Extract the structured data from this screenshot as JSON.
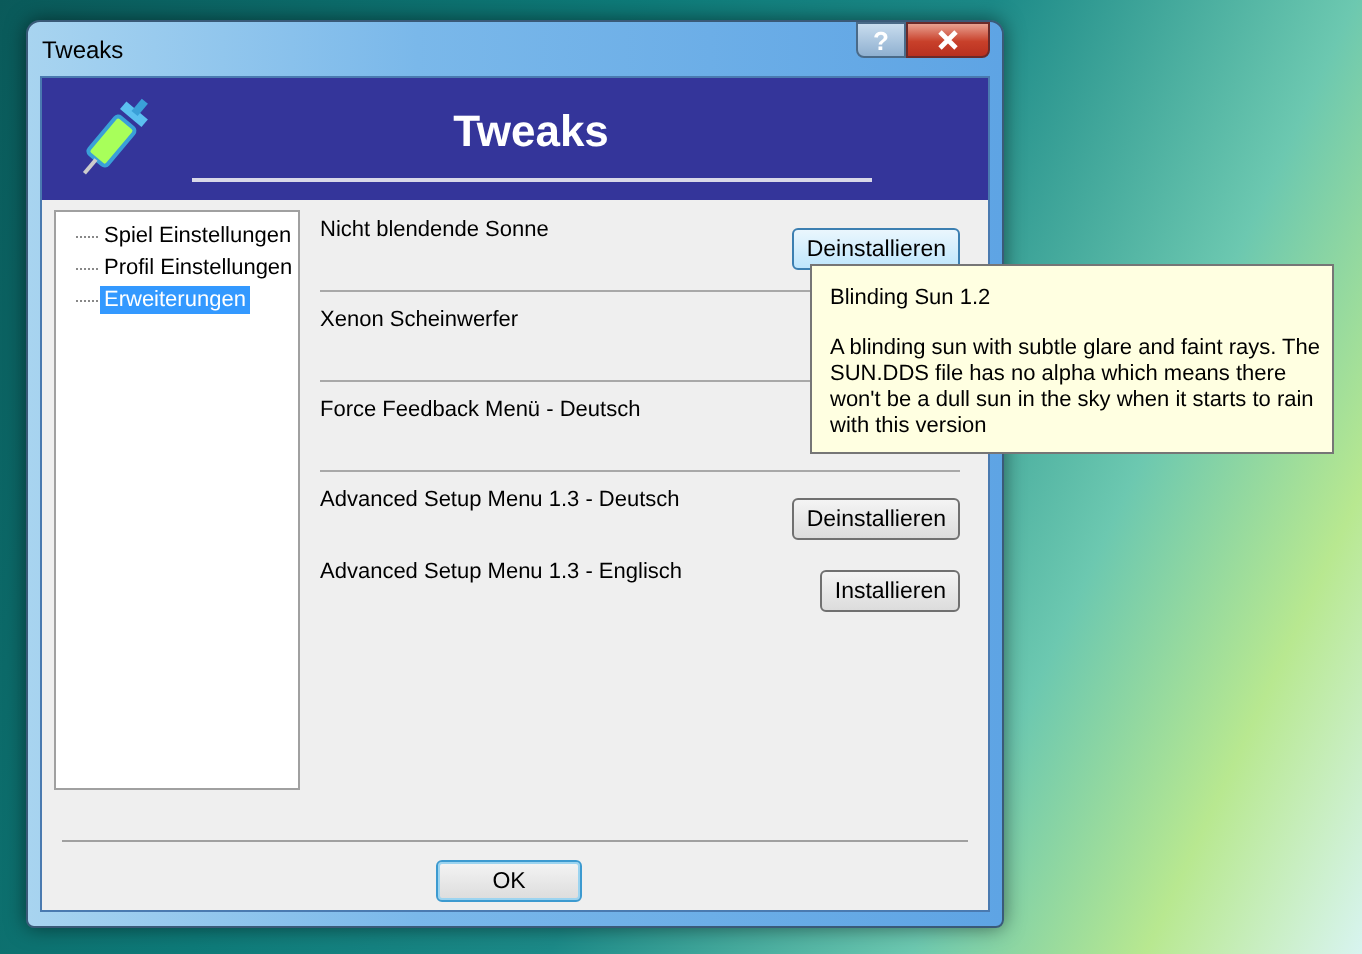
{
  "window": {
    "title": "Tweaks",
    "help_button": "?"
  },
  "header": {
    "title": "Tweaks"
  },
  "tree": [
    {
      "label": "Spiel Einstellungen",
      "selected": false
    },
    {
      "label": "Profil Einstellungen",
      "selected": false
    },
    {
      "label": "Erweiterungen",
      "selected": true
    }
  ],
  "groups": [
    {
      "rows": [
        {
          "label": "Nicht blendende Sonne",
          "button": "Deinstallieren",
          "hovered": true
        }
      ]
    },
    {
      "rows": [
        {
          "label": "Xenon Scheinwerfer"
        }
      ]
    },
    {
      "rows": [
        {
          "label": "Force Feedback Menü - Deutsch"
        }
      ]
    },
    {
      "rows": [
        {
          "label": "Advanced Setup Menu 1.3 - Deutsch",
          "button": "Deinstallieren",
          "hovered": false
        },
        {
          "label": "Advanced Setup Menu 1.3 - Englisch",
          "button": "Installieren",
          "hovered": false
        }
      ]
    }
  ],
  "tooltip": {
    "title": "Blinding Sun 1.2",
    "text": "A blinding sun with subtle glare and faint rays. The SUN.DDS file has no alpha which means there won't be a dull sun in the sky when it starts to rain with this version"
  },
  "ok_button": "OK"
}
